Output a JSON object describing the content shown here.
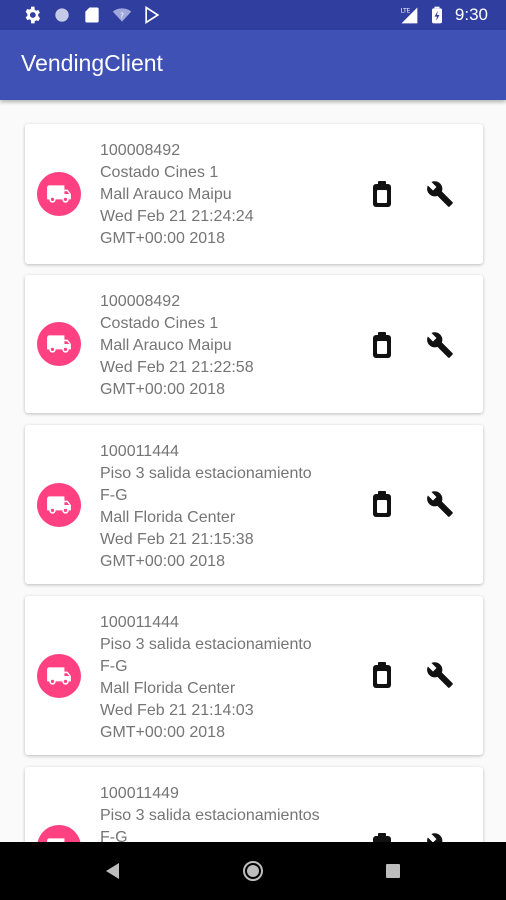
{
  "status_bar": {
    "time": "9:30",
    "left_icons": [
      "settings-icon",
      "circle-icon",
      "sd-card-icon",
      "wifi-off-icon",
      "play-store-icon"
    ],
    "right_icons": [
      "lte-signal-icon",
      "battery-charging-icon"
    ],
    "lte_label": "LTE"
  },
  "app_bar": {
    "title": "VendingClient",
    "color": "#3f51b5"
  },
  "accent_color": "#ff4081",
  "machines": [
    {
      "id": "100008492",
      "location_lines": [
        "Costado Cines 1"
      ],
      "mall": "Mall Arauco Maipu",
      "date_line1": "Wed Feb 21 21:24:24",
      "date_line2": "GMT+00:00 2018"
    },
    {
      "id": "100008492",
      "location_lines": [
        "Costado Cines 1"
      ],
      "mall": "Mall Arauco Maipu",
      "date_line1": "Wed Feb 21 21:22:58",
      "date_line2": "GMT+00:00 2018"
    },
    {
      "id": "100011444",
      "location_lines": [
        "Piso 3 salida estacionamiento",
        "F-G"
      ],
      "mall": "Mall Florida Center",
      "date_line1": "Wed Feb 21 21:15:38",
      "date_line2": "GMT+00:00 2018"
    },
    {
      "id": "100011444",
      "location_lines": [
        "Piso 3 salida estacionamiento",
        "F-G"
      ],
      "mall": "Mall Florida Center",
      "date_line1": "Wed Feb 21 21:14:03",
      "date_line2": "GMT+00:00 2018"
    },
    {
      "id": "100011449",
      "location_lines": [
        "Piso 3 salida estacionamientos",
        "F-G"
      ],
      "mall": "",
      "date_line1": "",
      "date_line2": ""
    }
  ],
  "card_actions": [
    "battery-icon",
    "wrench-icon"
  ],
  "nav_bar": [
    "back-icon",
    "home-icon",
    "recents-icon"
  ]
}
